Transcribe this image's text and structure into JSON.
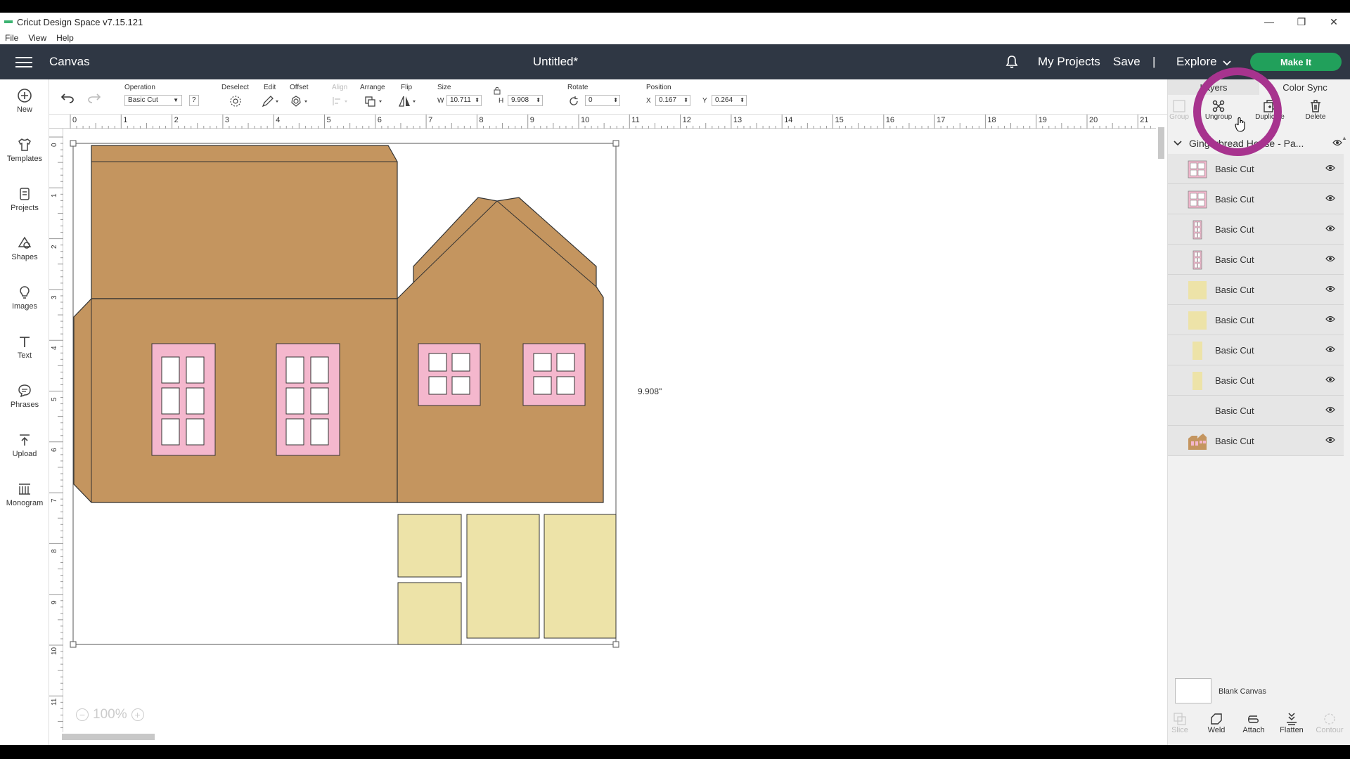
{
  "window": {
    "title": "Cricut Design Space  v7.15.121",
    "minimize": "—",
    "restore": "❐",
    "close": "✕"
  },
  "menu": [
    "File",
    "View",
    "Help"
  ],
  "header": {
    "canvas_label": "Canvas",
    "doc_title": "Untitled*",
    "my_projects": "My Projects",
    "save": "Save",
    "divider": "|",
    "explore": "Explore",
    "make_it": "Make It"
  },
  "sidebar": [
    {
      "label": "New",
      "icon": "plus-circle-icon"
    },
    {
      "label": "Templates",
      "icon": "shirt-icon"
    },
    {
      "label": "Projects",
      "icon": "projects-icon"
    },
    {
      "label": "Shapes",
      "icon": "shapes-icon"
    },
    {
      "label": "Images",
      "icon": "bulb-icon"
    },
    {
      "label": "Text",
      "icon": "text-icon"
    },
    {
      "label": "Phrases",
      "icon": "speech-bubble-icon"
    },
    {
      "label": "Upload",
      "icon": "upload-icon"
    },
    {
      "label": "Monogram",
      "icon": "monogram-icon"
    }
  ],
  "toolbar": {
    "operation_label": "Operation",
    "operation_value": "Basic Cut",
    "help_label": "?",
    "deselect_label": "Deselect",
    "edit_label": "Edit",
    "offset_label": "Offset",
    "align_label": "Align",
    "arrange_label": "Arrange",
    "flip_label": "Flip",
    "size_label": "Size",
    "w_label": "W",
    "w_value": "10.711",
    "h_label": "H",
    "h_value": "9.908",
    "rotate_label": "Rotate",
    "rotate_value": "0",
    "position_label": "Position",
    "x_label": "X",
    "x_value": "0.167",
    "y_label": "Y",
    "y_value": "0.264"
  },
  "ruler": {
    "top": [
      "0",
      "1",
      "2",
      "3",
      "4",
      "5",
      "6",
      "7",
      "8",
      "9",
      "10",
      "11",
      "12",
      "13",
      "14",
      "15",
      "16",
      "17",
      "18",
      "19",
      "20",
      "21"
    ],
    "left": [
      "0",
      "1",
      "2",
      "3",
      "4",
      "5",
      "6",
      "7",
      "8",
      "9",
      "10",
      "11"
    ]
  },
  "canvas": {
    "size_readout": "9.908\"",
    "zoom_level": "100%",
    "zoom_minus": "−",
    "zoom_plus": "+"
  },
  "panel": {
    "tab_layers": "Layers",
    "tab_colorsync": "Color Sync",
    "tools": [
      {
        "label": "Group",
        "enabled": false
      },
      {
        "label": "Ungroup",
        "enabled": true
      },
      {
        "label": "Duplicate",
        "enabled": true
      },
      {
        "label": "Delete",
        "enabled": true
      }
    ],
    "group_name": "Gingerbread House - Pa...",
    "layers": [
      {
        "name": "Basic Cut",
        "thumb": "pink-window-square",
        "color": "#f4b7cd"
      },
      {
        "name": "Basic Cut",
        "thumb": "pink-window-square",
        "color": "#f4b7cd"
      },
      {
        "name": "Basic Cut",
        "thumb": "pink-window-tall",
        "color": "#f4b7cd"
      },
      {
        "name": "Basic Cut",
        "thumb": "pink-window-tall",
        "color": "#f4b7cd"
      },
      {
        "name": "Basic Cut",
        "thumb": "yellow-square",
        "color": "#ede3a8"
      },
      {
        "name": "Basic Cut",
        "thumb": "yellow-square",
        "color": "#ede3a8"
      },
      {
        "name": "Basic Cut",
        "thumb": "yellow-tall",
        "color": "#ede3a8"
      },
      {
        "name": "Basic Cut",
        "thumb": "yellow-tall",
        "color": "#ede3a8"
      },
      {
        "name": "Basic Cut",
        "thumb": "white-blank",
        "color": "#ffffff"
      },
      {
        "name": "Basic Cut",
        "thumb": "brown-house",
        "color": "#c4955f"
      }
    ],
    "blank_canvas": "Blank Canvas",
    "bottom_tools": [
      {
        "label": "Slice",
        "enabled": false
      },
      {
        "label": "Weld",
        "enabled": true
      },
      {
        "label": "Attach",
        "enabled": true
      },
      {
        "label": "Flatten",
        "enabled": true
      },
      {
        "label": "Contour",
        "enabled": false
      }
    ]
  },
  "colors": {
    "header": "#2f3744",
    "accent_green": "#21a05b",
    "house_brown": "#c4955f",
    "window_pink": "#f4b7cd",
    "panel_yellow": "#ede3a8",
    "highlight": "#a7338e"
  }
}
